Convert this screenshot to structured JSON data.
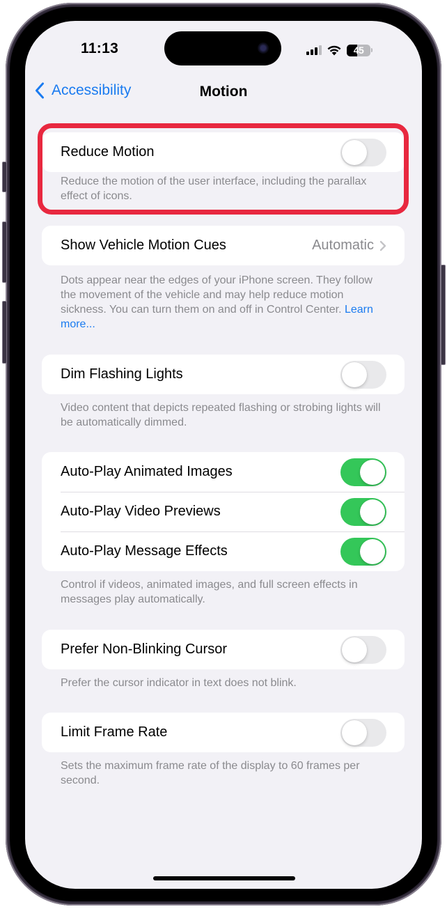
{
  "status_bar": {
    "time": "11:13",
    "battery_percent": "45",
    "battery_level": 0.45,
    "signal_bars_active": 3,
    "signal_bars_total": 4,
    "icons": [
      "signal-icon",
      "wifi-icon",
      "battery-icon"
    ]
  },
  "nav": {
    "back_label": "Accessibility",
    "title": "Motion"
  },
  "colors": {
    "accent": "#1a7bf0",
    "toggle_on": "#34c759",
    "toggle_off": "#e9e9eb",
    "highlight": "#e8283f",
    "background": "#f2f1f6"
  },
  "sections": [
    {
      "rows": [
        {
          "label": "Reduce Motion",
          "type": "toggle",
          "on": false
        }
      ],
      "footer": "Reduce the motion of the user interface, including the parallax effect of icons.",
      "highlighted": true
    },
    {
      "rows": [
        {
          "label": "Show Vehicle Motion Cues",
          "type": "disclosure",
          "value": "Automatic"
        }
      ],
      "footer": "Dots appear near the edges of your iPhone screen. They follow the movement of the vehicle and may help reduce motion sickness. You can turn them on and off in Control Center.",
      "footer_link": "Learn more..."
    },
    {
      "rows": [
        {
          "label": "Dim Flashing Lights",
          "type": "toggle",
          "on": false
        }
      ],
      "footer": "Video content that depicts repeated flashing or strobing lights will be automatically dimmed."
    },
    {
      "rows": [
        {
          "label": "Auto-Play Animated Images",
          "type": "toggle",
          "on": true
        },
        {
          "label": "Auto-Play Video Previews",
          "type": "toggle",
          "on": true
        },
        {
          "label": "Auto-Play Message Effects",
          "type": "toggle",
          "on": true
        }
      ],
      "footer": "Control if videos, animated images, and full screen effects in messages play automatically."
    },
    {
      "rows": [
        {
          "label": "Prefer Non-Blinking Cursor",
          "type": "toggle",
          "on": false
        }
      ],
      "footer": "Prefer the cursor indicator in text does not blink."
    },
    {
      "rows": [
        {
          "label": "Limit Frame Rate",
          "type": "toggle",
          "on": false
        }
      ],
      "footer": "Sets the maximum frame rate of the display to 60 frames per second."
    }
  ]
}
